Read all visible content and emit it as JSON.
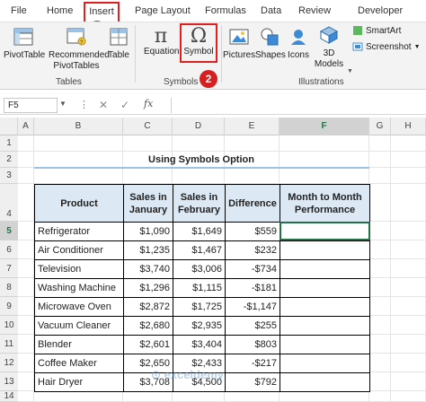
{
  "tabs": [
    "File",
    "Home",
    "Insert",
    "Page Layout",
    "Formulas",
    "Data",
    "Review",
    "Developer"
  ],
  "badges": {
    "one": "1",
    "two": "2"
  },
  "ribbon": {
    "pivottable": "PivotTable",
    "recommended": "Recommended",
    "pivottables": "PivotTables",
    "table": "Table",
    "equation": "Equation",
    "symbol": "Symbol",
    "pictures": "Pictures",
    "shapes": "Shapes",
    "icons": "Icons",
    "models_3d": "3D",
    "models": "Models",
    "smartart": "SmartArt",
    "screenshot": "Screenshot",
    "group_tables": "Tables",
    "group_symbols": "Symbols",
    "group_illustrations": "Illustrations"
  },
  "formula": {
    "namebox": "F5",
    "fx": "fx"
  },
  "columns": [
    "A",
    "B",
    "C",
    "D",
    "E",
    "F",
    "G",
    "H"
  ],
  "rows": [
    "1",
    "2",
    "3",
    "4",
    "5",
    "6",
    "7",
    "8",
    "9",
    "10",
    "11",
    "12",
    "13",
    "14"
  ],
  "sheet": {
    "title": "Using Symbols Option",
    "headers": [
      "Product",
      "Sales in January",
      "Sales in February",
      "Difference",
      "Month to Month Performance"
    ],
    "data": [
      [
        "Refrigerator",
        "$1,090",
        "$1,649",
        "$559"
      ],
      [
        "Air Conditioner",
        "$1,235",
        "$1,467",
        "$232"
      ],
      [
        "Television",
        "$3,740",
        "$3,006",
        "-$734"
      ],
      [
        "Washing Machine",
        "$1,296",
        "$1,115",
        "-$181"
      ],
      [
        "Microwave Oven",
        "$2,872",
        "$1,725",
        "-$1,147"
      ],
      [
        "Vacuum Cleaner",
        "$2,680",
        "$2,935",
        "$255"
      ],
      [
        "Blender",
        "$2,601",
        "$3,404",
        "$803"
      ],
      [
        "Coffee Maker",
        "$2,650",
        "$2,433",
        "-$217"
      ],
      [
        "Hair Dryer",
        "$3,708",
        "$4,500",
        "$792"
      ]
    ]
  },
  "colors": {
    "accent": "#e02020",
    "header_fill": "#dce9f5",
    "selected": "#217346"
  }
}
